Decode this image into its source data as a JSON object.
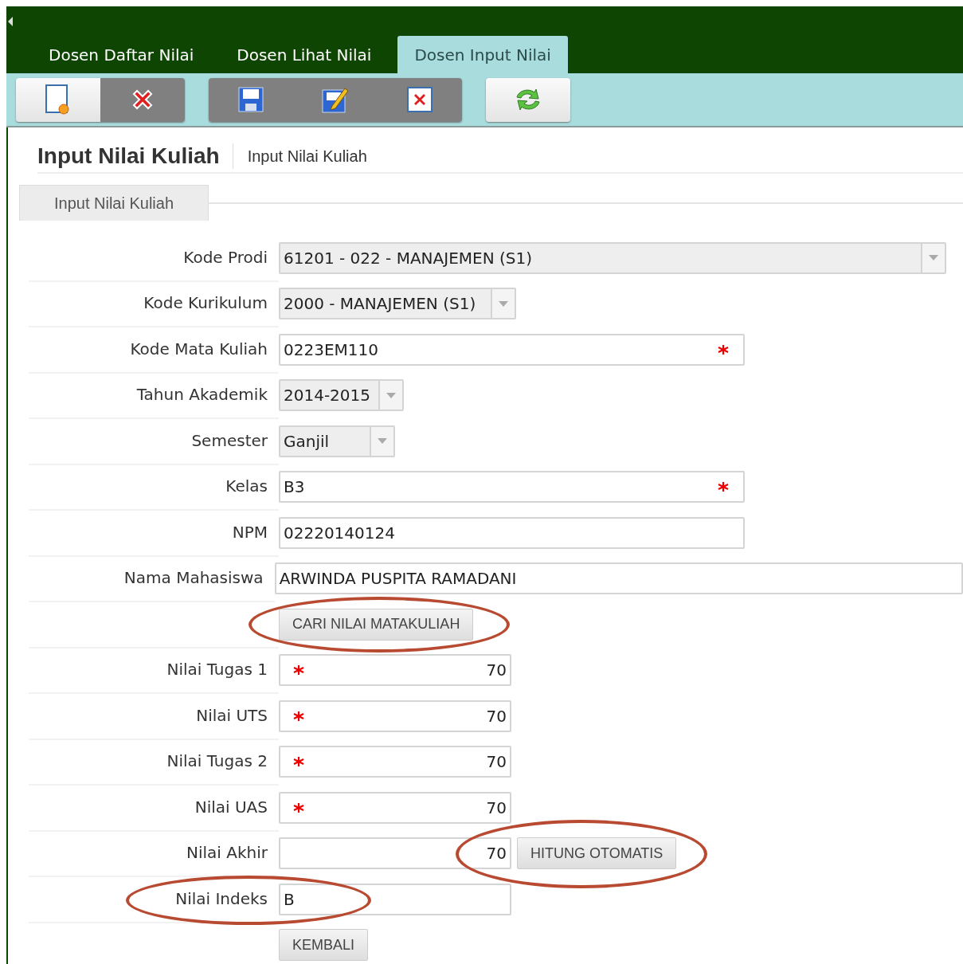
{
  "tabs": [
    {
      "label": "Dosen Daftar Nilai",
      "selected": false
    },
    {
      "label": "Dosen Lihat Nilai",
      "selected": false
    },
    {
      "label": "Dosen Input Nilai",
      "selected": true
    }
  ],
  "toolbar": [
    [
      {
        "disabled": false
      },
      {
        "disabled": true
      }
    ],
    [
      {
        "disabled": true
      },
      {
        "disabled": true
      },
      {
        "disabled": true
      }
    ],
    [
      {
        "disabled": false
      }
    ]
  ],
  "page": {
    "title": "Input Nilai Kuliah",
    "breadcrumb": "Input Nilai Kuliah"
  },
  "section_tab": "Input Nilai Kuliah",
  "rows": [
    {
      "kind": "select",
      "label": "Kode Prodi",
      "value": "61201 - 022 - MANAJEMEN (S1)",
      "annotated": false
    },
    {
      "kind": "select",
      "label": "Kode Kurikulum",
      "value": "2000 - MANAJEMEN (S1)",
      "annotated": false
    },
    {
      "kind": "text",
      "label": "Kode Mata Kuliah",
      "value": "0223EM110",
      "required": true,
      "annotated": false
    },
    {
      "kind": "select",
      "label": "Tahun Akademik",
      "value": "2014-2015",
      "annotated": false
    },
    {
      "kind": "select",
      "label": "Semester",
      "value": "Ganjil",
      "annotated": false
    },
    {
      "kind": "text",
      "label": "Kelas",
      "value": "B3",
      "required": true,
      "annotated": false
    },
    {
      "kind": "text",
      "label": "NPM",
      "value": "02220140124",
      "required": false,
      "annotated": false
    },
    {
      "kind": "text",
      "label": "Nama Mahasiswa",
      "value": "ARWINDA PUSPITA RAMADANI",
      "required": false,
      "annotated": false
    },
    {
      "kind": "button",
      "label": "CARI NILAI MATAKULIAH",
      "annotated": true
    },
    {
      "kind": "number",
      "label": "Nilai Tugas 1",
      "value": "70",
      "required": true,
      "annotated": false
    },
    {
      "kind": "number",
      "label": "Nilai UTS",
      "value": "70",
      "required": true,
      "annotated": false
    },
    {
      "kind": "number",
      "label": "Nilai Tugas 2",
      "value": "70",
      "required": true,
      "annotated": false
    },
    {
      "kind": "number",
      "label": "Nilai UAS",
      "value": "70",
      "required": true,
      "annotated": false
    },
    {
      "kind": "number",
      "label": "Nilai Akhir",
      "value": "70",
      "required": false,
      "button": "HITUNG OTOMATIS",
      "annotated": true
    },
    {
      "kind": "text",
      "label": "Nilai Indeks",
      "value": "B",
      "required": false,
      "annotated": true
    },
    {
      "kind": "button",
      "label": "KEMBALI",
      "annotated": false
    }
  ]
}
